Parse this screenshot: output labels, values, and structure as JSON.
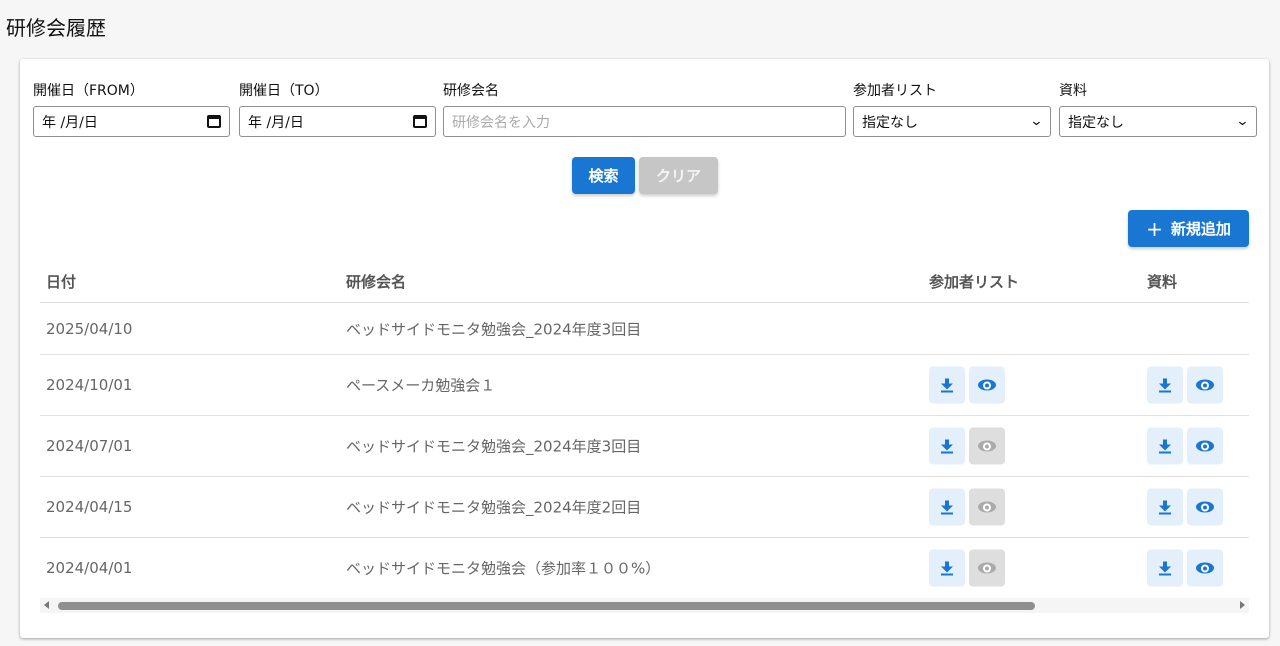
{
  "page": {
    "title": "研修会履歴"
  },
  "filters": {
    "date_from": {
      "label": "開催日（FROM）",
      "value": "年 /月/日"
    },
    "date_to": {
      "label": "開催日（TO）",
      "value": "年 /月/日"
    },
    "name": {
      "label": "研修会名",
      "placeholder": "研修会名を入力"
    },
    "participants": {
      "label": "参加者リスト",
      "selected": "指定なし"
    },
    "materials": {
      "label": "資料",
      "selected": "指定なし"
    }
  },
  "buttons": {
    "search": "検索",
    "clear": "クリア",
    "add": "新規追加",
    "add_icon": "+"
  },
  "table": {
    "headers": {
      "date": "日付",
      "name": "研修会名",
      "participants": "参加者リスト",
      "materials": "資料"
    },
    "rows": [
      {
        "date": "2025/04/10",
        "name": "ベッドサイドモニタ勉強会_2024年度3回目",
        "participants_download": false,
        "participants_view": null,
        "materials_download": false,
        "materials_view": null
      },
      {
        "date": "2024/10/01",
        "name": "ペースメーカ勉強会１",
        "participants_download": true,
        "participants_view": "enabled",
        "materials_download": true,
        "materials_view": "enabled"
      },
      {
        "date": "2024/07/01",
        "name": "ベッドサイドモニタ勉強会_2024年度3回目",
        "participants_download": true,
        "participants_view": "disabled",
        "materials_download": true,
        "materials_view": "enabled"
      },
      {
        "date": "2024/04/15",
        "name": "ベッドサイドモニタ勉強会_2024年度2回目",
        "participants_download": true,
        "participants_view": "disabled",
        "materials_download": true,
        "materials_view": "enabled"
      },
      {
        "date": "2024/04/01",
        "name": "ベッドサイドモニタ勉強会（参加率１００%）",
        "participants_download": true,
        "participants_view": "disabled",
        "materials_download": true,
        "materials_view": "enabled"
      }
    ]
  },
  "icons": {
    "download": "download-icon",
    "view": "eye-icon",
    "calendar": "calendar-icon",
    "dropdown": "chevron-down-icon"
  },
  "colors": {
    "primary": "#1976d2",
    "disabled": "#c6c6c6",
    "icon_bg": "#e3effa"
  }
}
